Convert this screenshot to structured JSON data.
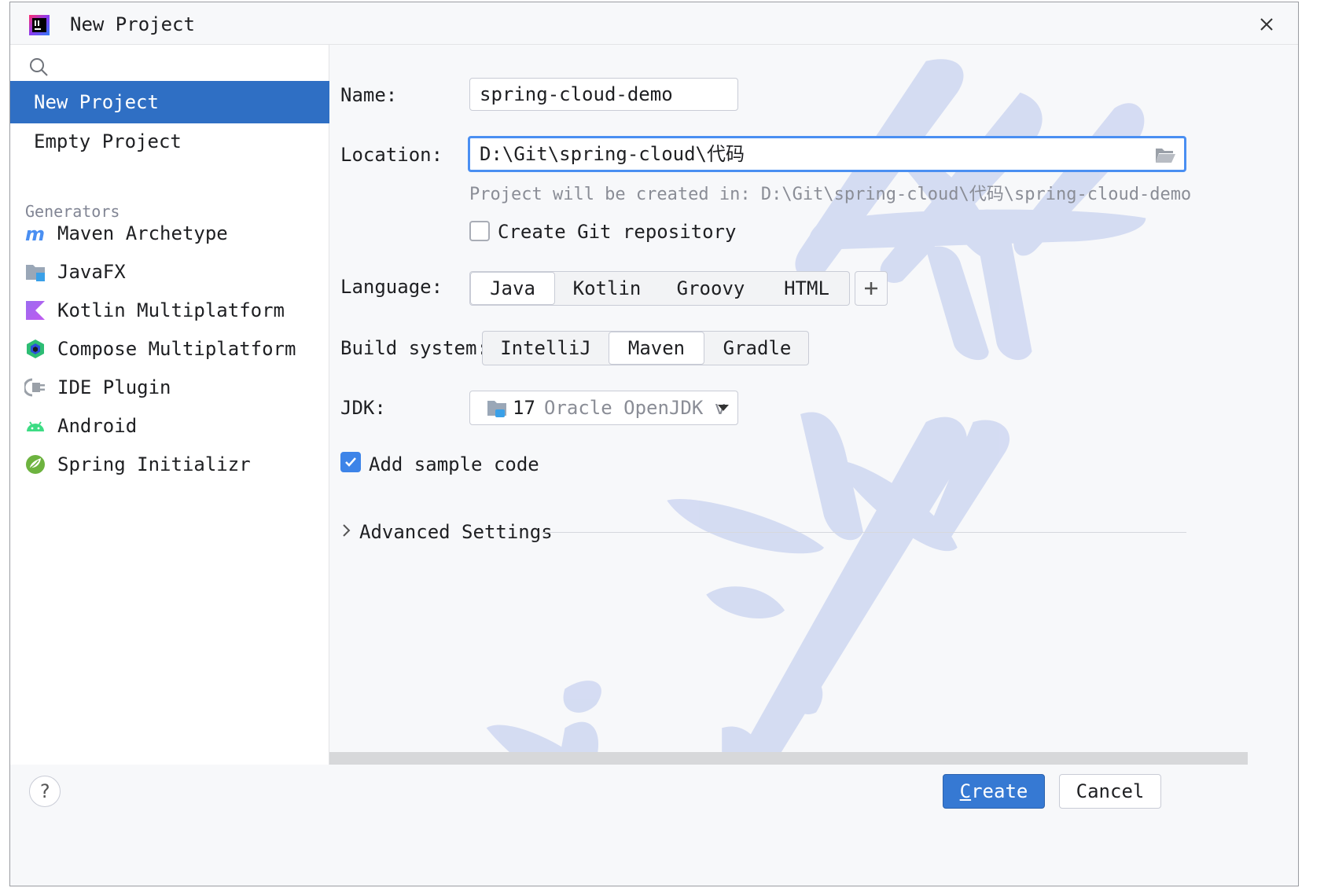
{
  "window": {
    "title": "New Project"
  },
  "sidebar": {
    "search_placeholder": "",
    "project_types": [
      {
        "label": "New Project",
        "selected": true
      },
      {
        "label": "Empty Project",
        "selected": false
      }
    ],
    "generators_header": "Generators",
    "generators": [
      {
        "label": "Maven Archetype",
        "icon": "maven-icon"
      },
      {
        "label": "JavaFX",
        "icon": "javafx-icon"
      },
      {
        "label": "Kotlin Multiplatform",
        "icon": "kotlin-icon"
      },
      {
        "label": "Compose Multiplatform",
        "icon": "compose-icon"
      },
      {
        "label": "IDE Plugin",
        "icon": "plugin-icon"
      },
      {
        "label": "Android",
        "icon": "android-icon"
      },
      {
        "label": "Spring Initializr",
        "icon": "spring-icon"
      }
    ]
  },
  "form": {
    "name_label": "Name:",
    "name_value": "spring-cloud-demo",
    "location_label": "Location:",
    "location_value": "D:\\Git\\spring-cloud\\代码",
    "location_hint": "Project will be created in: D:\\Git\\spring-cloud\\代码\\spring-cloud-demo",
    "git_label": "Create Git repository",
    "git_checked": false,
    "language_label": "Language:",
    "languages": [
      "Java",
      "Kotlin",
      "Groovy",
      "HTML"
    ],
    "language_selected": "Java",
    "build_label": "Build system:",
    "build_systems": [
      "IntelliJ",
      "Maven",
      "Gradle"
    ],
    "build_selected": "Maven",
    "jdk_label": "JDK:",
    "jdk_version": "17",
    "jdk_name": "Oracle OpenJDK v",
    "sample_label": "Add sample code",
    "sample_checked": true,
    "advanced_label": "Advanced Settings"
  },
  "footer": {
    "help_label": "?",
    "create_mnemonic": "C",
    "create_rest": "reate",
    "cancel_label": "Cancel"
  },
  "colors": {
    "accent": "#2f6fc4",
    "primary_button": "#3679d3",
    "focus": "#4a8ff2",
    "watermark": "#c9d3f0"
  }
}
